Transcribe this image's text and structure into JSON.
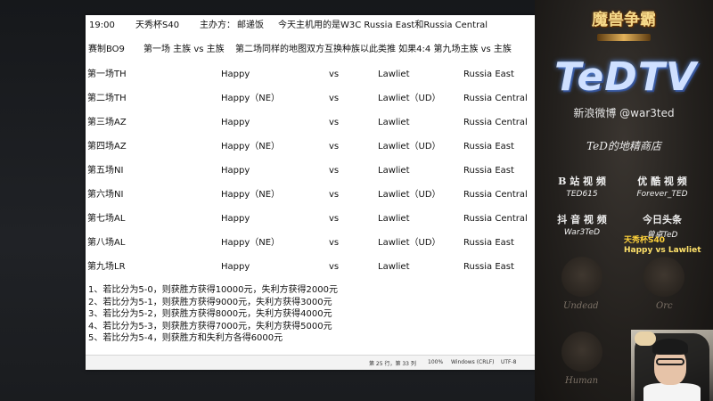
{
  "notepad": {
    "header_line1": {
      "time": "19:00",
      "event": "天秀杯S40",
      "organizer": "主办方：",
      "organizer_name": "邮递饭",
      "host_note": "今天主机用的是W3C Russia East和Russia Central"
    },
    "header_line2": {
      "format": "赛制BO9",
      "rule": "第一场 主族 vs 主族",
      "rule2": "第二场同样的地图双方互换种族以此类推 如果4:4 第九场主族 vs 主族"
    },
    "games": [
      {
        "game": "第一场TH",
        "p1": "Happy",
        "vs": "vs",
        "p2": "Lawliet",
        "server": "Russia East"
      },
      {
        "game": "第二场TH",
        "p1": "Happy（NE）",
        "vs": "vs",
        "p2": "Lawliet（UD）",
        "server": "Russia Central"
      },
      {
        "game": "第三场AZ",
        "p1": "Happy",
        "vs": "vs",
        "p2": "Lawliet",
        "server": "Russia Central"
      },
      {
        "game": "第四场AZ",
        "p1": "Happy（NE）",
        "vs": "vs",
        "p2": "Lawliet（UD）",
        "server": "Russia East"
      },
      {
        "game": "第五场NI",
        "p1": "Happy",
        "vs": "vs",
        "p2": "Lawliet",
        "server": "Russia East"
      },
      {
        "game": "第六场NI",
        "p1": "Happy（NE）",
        "vs": "vs",
        "p2": "Lawliet（UD）",
        "server": "Russia Central"
      },
      {
        "game": "第七场AL",
        "p1": "Happy",
        "vs": "vs",
        "p2": "Lawliet",
        "server": "Russia Central"
      },
      {
        "game": "第八场AL",
        "p1": "Happy（NE）",
        "vs": "vs",
        "p2": "Lawliet（UD）",
        "server": "Russia East"
      },
      {
        "game": "第九场LR",
        "p1": "Happy",
        "vs": "vs",
        "p2": "Lawliet",
        "server": "Russia East"
      }
    ],
    "prizes": [
      "1、若比分为5-0，则获胜方获得10000元，失利方获得2000元",
      "2、若比分为5-1，则获胜方获得9000元，失利方获得3000元",
      "3、若比分为5-2，则获胜方获得8000元，失利方获得4000元",
      "4、若比分为5-3，则获胜方获得7000元，失利方获得5000元",
      "5、若比分为5-4，则获胜方和失利方各得6000元"
    ],
    "status": {
      "position": "第 25 行，第 33 列",
      "zoom": "100%",
      "line_ending": "Windows (CRLF)",
      "encoding": "UTF-8"
    }
  },
  "sidebar": {
    "game_logo": "魔兽争霸",
    "brand": "TeDTV",
    "weibo": "新浪微博 @war3ted",
    "shop": "TeD的地精商店",
    "socials": [
      {
        "platform": "B 站 视 频",
        "handle": "TED615"
      },
      {
        "platform": "优 酷 视 频",
        "handle": "Forever_TED"
      },
      {
        "platform": "抖 音 视 频",
        "handle": "War3TeD"
      },
      {
        "platform": "今日头条",
        "handle": "曾卓TeD"
      }
    ],
    "match_title": "天秀杯S40",
    "match_players": "Happy vs Lawliet",
    "races": [
      "Undead",
      "Orc",
      "Human"
    ]
  }
}
